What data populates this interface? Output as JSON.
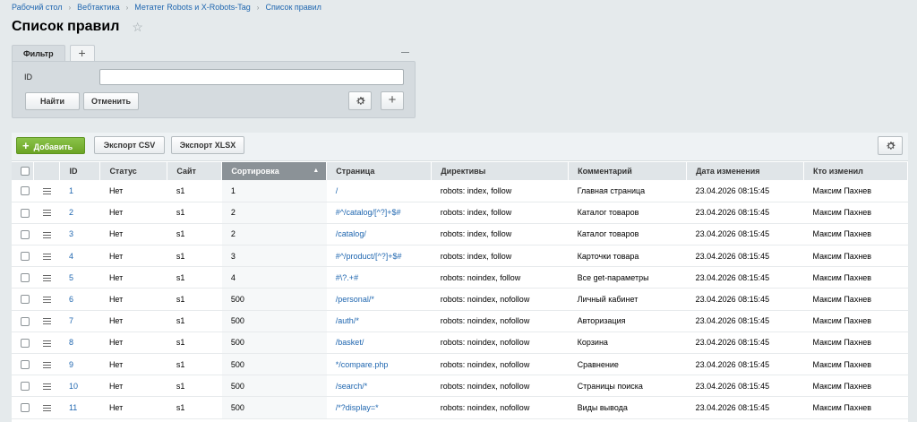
{
  "breadcrumbs": [
    "Рабочий стол",
    "Вебтактика",
    "Метатег Robots и X-Robots-Tag",
    "Список правил"
  ],
  "breadcrumb_separator": "›",
  "page_title": "Список правил",
  "filter": {
    "tab_label": "Фильтр",
    "add_tab": "+",
    "field_label": "ID",
    "field_value": "",
    "find_label": "Найти",
    "cancel_label": "Отменить",
    "plus_label": "+"
  },
  "toolbar": {
    "add_label": "Добавить",
    "export_csv": "Экспорт CSV",
    "export_xlsx": "Экспорт XLSX"
  },
  "table": {
    "columns": [
      "ID",
      "Статус",
      "Сайт",
      "Сортировка",
      "Страница",
      "Директивы",
      "Комментарий",
      "Дата изменения",
      "Кто изменил"
    ],
    "sorted_column": "Сортировка",
    "rows": [
      {
        "id": "1",
        "status": "Нет",
        "site": "s1",
        "sort": "1",
        "page": "/",
        "directives": "robots: index, follow",
        "comment": "Главная страница",
        "date": "23.04.2026 08:15:45",
        "author": "Максим Пахнев"
      },
      {
        "id": "2",
        "status": "Нет",
        "site": "s1",
        "sort": "2",
        "page": "#^/catalog/[^?]+$#",
        "directives": "robots: index, follow",
        "comment": "Каталог товаров",
        "date": "23.04.2026 08:15:45",
        "author": "Максим Пахнев"
      },
      {
        "id": "3",
        "status": "Нет",
        "site": "s1",
        "sort": "2",
        "page": "/catalog/",
        "directives": "robots: index, follow",
        "comment": "Каталог товаров",
        "date": "23.04.2026 08:15:45",
        "author": "Максим Пахнев"
      },
      {
        "id": "4",
        "status": "Нет",
        "site": "s1",
        "sort": "3",
        "page": "#^/product/[^?]+$#",
        "directives": "robots: index, follow",
        "comment": "Карточки товара",
        "date": "23.04.2026 08:15:45",
        "author": "Максим Пахнев"
      },
      {
        "id": "5",
        "status": "Нет",
        "site": "s1",
        "sort": "4",
        "page": "#\\?.+#",
        "directives": "robots: noindex, follow",
        "comment": "Все get-параметры",
        "date": "23.04.2026 08:15:45",
        "author": "Максим Пахнев"
      },
      {
        "id": "6",
        "status": "Нет",
        "site": "s1",
        "sort": "500",
        "page": "/personal/*",
        "directives": "robots: noindex, nofollow",
        "comment": "Личный кабинет",
        "date": "23.04.2026 08:15:45",
        "author": "Максим Пахнев"
      },
      {
        "id": "7",
        "status": "Нет",
        "site": "s1",
        "sort": "500",
        "page": "/auth/*",
        "directives": "robots: noindex, nofollow",
        "comment": "Авторизация",
        "date": "23.04.2026 08:15:45",
        "author": "Максим Пахнев"
      },
      {
        "id": "8",
        "status": "Нет",
        "site": "s1",
        "sort": "500",
        "page": "/basket/",
        "directives": "robots: noindex, nofollow",
        "comment": "Корзина",
        "date": "23.04.2026 08:15:45",
        "author": "Максим Пахнев"
      },
      {
        "id": "9",
        "status": "Нет",
        "site": "s1",
        "sort": "500",
        "page": "*/compare.php",
        "directives": "robots: noindex, nofollow",
        "comment": "Сравнение",
        "date": "23.04.2026 08:15:45",
        "author": "Максим Пахнев"
      },
      {
        "id": "10",
        "status": "Нет",
        "site": "s1",
        "sort": "500",
        "page": "/search/*",
        "directives": "robots: noindex, nofollow",
        "comment": "Страницы поиска",
        "date": "23.04.2026 08:15:45",
        "author": "Максим Пахнев"
      },
      {
        "id": "11",
        "status": "Нет",
        "site": "s1",
        "sort": "500",
        "page": "/*?display=*",
        "directives": "robots: noindex, nofollow",
        "comment": "Виды вывода",
        "date": "23.04.2026 08:15:45",
        "author": "Максим Пахнев"
      }
    ]
  }
}
